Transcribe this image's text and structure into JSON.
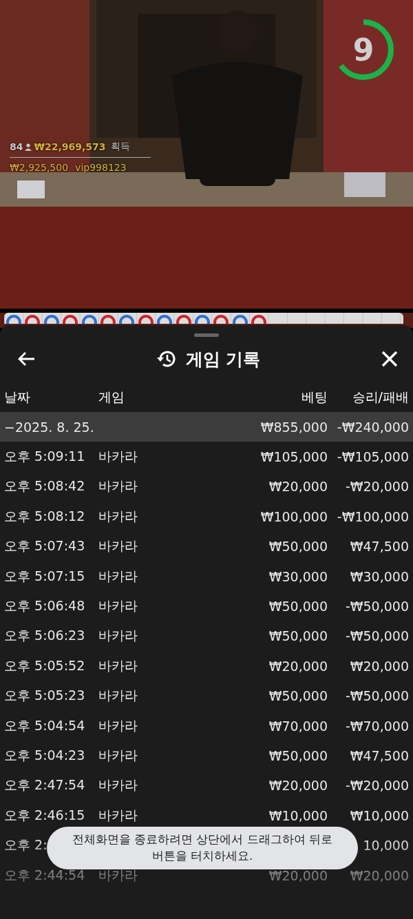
{
  "video": {
    "kind": "picture",
    "timer": {
      "count": "9",
      "level": 0.65
    },
    "overlay": {
      "players": "84",
      "winnings": "₩22,969,573",
      "winnings_label": "획득",
      "top_bet": "₩2,925,500",
      "top_user": "vip998123"
    }
  },
  "roadmap": [
    {
      "color": "#2f6fd0"
    },
    {
      "color": "#c8262e"
    },
    {
      "color": "#2f6fd0"
    },
    {
      "color": "#c8262e"
    },
    {
      "color": "#2f6fd0"
    },
    {
      "color": "#c8262e"
    },
    {
      "color": "#2f6fd0"
    },
    {
      "color": "#c8262e"
    },
    {
      "color": "#2f6fd0"
    },
    {
      "color": "#c8262e"
    },
    {
      "color": "#2f6fd0"
    },
    {
      "color": "#c8262e"
    },
    {
      "color": "#2f6fd0"
    },
    {
      "color": "#c8262e"
    }
  ],
  "sheet": {
    "title": "게임 기록",
    "table": {
      "columns": [
        "날짜",
        "게임",
        "베팅",
        "승리/패배"
      ],
      "group": {
        "date": "−2025. 8. 25.",
        "bet": "₩855,000",
        "result": "-₩240,000"
      },
      "rows": [
        {
          "time": "오후 5:09:11",
          "game": "바카라",
          "bet": "₩105,000",
          "result": "-₩105,000"
        },
        {
          "time": "오후 5:08:42",
          "game": "바카라",
          "bet": "₩20,000",
          "result": "-₩20,000"
        },
        {
          "time": "오후 5:08:12",
          "game": "바카라",
          "bet": "₩100,000",
          "result": "-₩100,000"
        },
        {
          "time": "오후 5:07:43",
          "game": "바카라",
          "bet": "₩50,000",
          "result": "₩47,500"
        },
        {
          "time": "오후 5:07:15",
          "game": "바카라",
          "bet": "₩30,000",
          "result": "₩30,000"
        },
        {
          "time": "오후 5:06:48",
          "game": "바카라",
          "bet": "₩50,000",
          "result": "-₩50,000"
        },
        {
          "time": "오후 5:06:23",
          "game": "바카라",
          "bet": "₩50,000",
          "result": "-₩50,000"
        },
        {
          "time": "오후 5:05:52",
          "game": "바카라",
          "bet": "₩20,000",
          "result": "₩20,000"
        },
        {
          "time": "오후 5:05:23",
          "game": "바카라",
          "bet": "₩50,000",
          "result": "-₩50,000"
        },
        {
          "time": "오후 5:04:54",
          "game": "바카라",
          "bet": "₩70,000",
          "result": "-₩70,000"
        },
        {
          "time": "오후 5:04:23",
          "game": "바카라",
          "bet": "₩50,000",
          "result": "₩47,500"
        },
        {
          "time": "오후 2:47:54",
          "game": "바카라",
          "bet": "₩20,000",
          "result": "-₩20,000"
        },
        {
          "time": "오후 2:46:15",
          "game": "바카라",
          "bet": "₩10,000",
          "result": "₩10,000"
        },
        {
          "time": "오후 2:",
          "result": "10,000"
        },
        {
          "time": "오후 2:44:54",
          "game": "바카라",
          "bet": "₩20,000",
          "result": "₩20,000"
        }
      ]
    }
  },
  "toast": "전체화면을 종료하려면 상단에서 드래그하여 뒤로 버튼을 터치하세요."
}
